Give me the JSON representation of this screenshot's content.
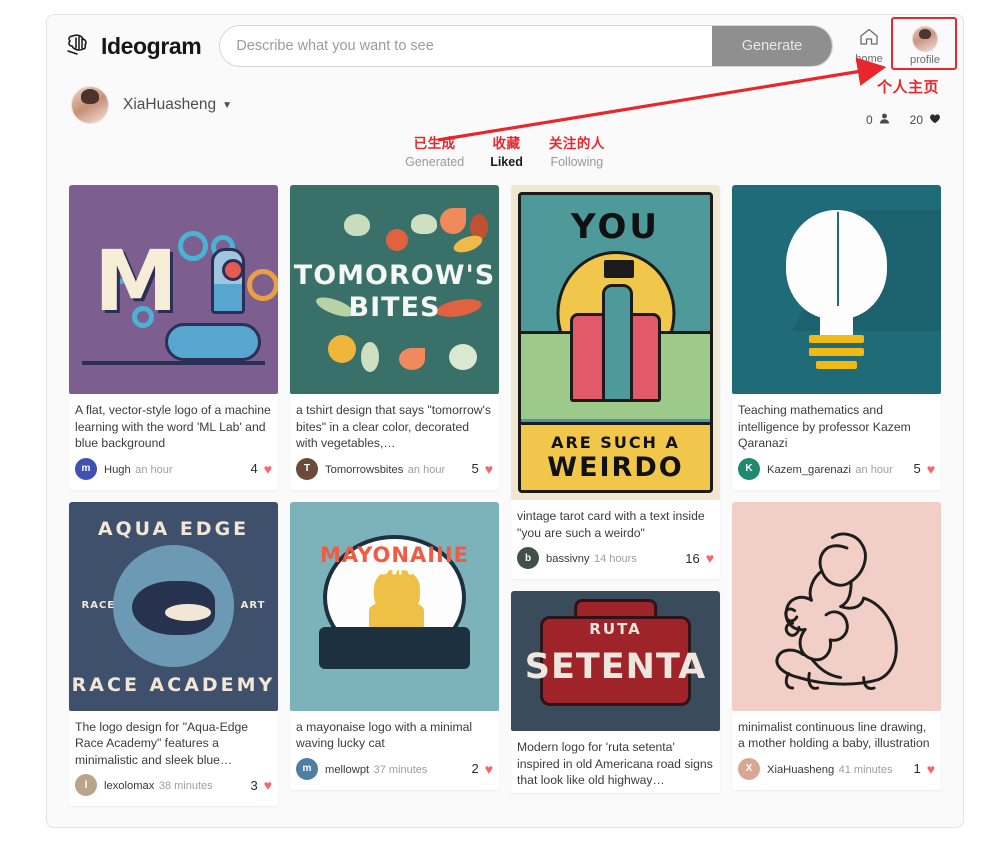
{
  "header": {
    "brand": "Ideogram",
    "logo_icon": "ideogram-brain-logo-icon",
    "search_placeholder": "Describe what you want to see",
    "search_value": "",
    "generate_label": "Generate",
    "nav": [
      {
        "name": "home",
        "label": "home",
        "icon": "home-icon"
      },
      {
        "name": "profile",
        "label": "profile",
        "icon": "avatar-icon"
      }
    ]
  },
  "annotations": {
    "profile_label_cn": "个人主页",
    "highlight_color": "#e8262b",
    "arrow": "red-arrow-pointing-to-profile"
  },
  "profile": {
    "username": "XiaHuasheng",
    "caret_icon": "chevron-down-icon",
    "avatar_icon": "user-avatar",
    "stats": {
      "followers": "0",
      "followers_icon": "person-icon",
      "likes": "20",
      "likes_icon": "heart-icon"
    }
  },
  "tabs": [
    {
      "cn": "已生成",
      "en": "Generated",
      "active": false
    },
    {
      "cn": "收藏",
      "en": "Liked",
      "active": true
    },
    {
      "cn": "关注的人",
      "en": "Following",
      "active": false
    }
  ],
  "feed": {
    "columns": [
      [
        {
          "art": "ml-lab",
          "caption": "A flat, vector-style logo of a machine learning with the word 'ML Lab' and blue background",
          "author": "Hugh",
          "author_initial": "m",
          "avatar_color": "#3f51b5",
          "time": "an hour",
          "likes": "4"
        },
        {
          "art": "aqua-edge",
          "caption": "The logo design for \"Aqua-Edge Race Academy\" features a minimalistic and sleek blue…",
          "author": "lexolomax",
          "author_initial": "l",
          "avatar_color": "#b9a48c",
          "time": "38 minutes",
          "likes": "3"
        }
      ],
      [
        {
          "art": "tomorrows-bites",
          "caption": "a tshirt design that says \"tomorrow's bites\" in a clear color, decorated with vegetables,…",
          "author": "Tomorrowsbites",
          "author_initial": "T",
          "avatar_color": "#6b4a3a",
          "time": "an hour",
          "likes": "5"
        },
        {
          "art": "mayonaise",
          "caption": "a mayonaise logo with a minimal waving lucky cat",
          "author": "mellowpt",
          "author_initial": "m",
          "avatar_color": "#4e7fa3",
          "time": "37 minutes",
          "likes": "2"
        }
      ],
      [
        {
          "art": "tarot-weirdo",
          "caption": "vintage tarot card with a text inside \"you are such a weirdo\"",
          "author": "bassivny",
          "author_initial": "b",
          "avatar_color": "#41514a",
          "time": "14 hours",
          "likes": "16"
        },
        {
          "art": "ruta-setenta",
          "caption": "Modern logo for 'ruta setenta' inspired in old Americana road signs that look like old highway…",
          "author": "",
          "author_initial": "",
          "avatar_color": "#888888",
          "time": "",
          "likes": ""
        }
      ],
      [
        {
          "art": "brain-bulb",
          "caption": "Teaching mathematics and intelligence by professor Kazem Qaranazi",
          "author": "Kazem_garenazi",
          "author_initial": "K",
          "avatar_color": "#1f8a6d",
          "time": "an hour",
          "likes": "5"
        },
        {
          "art": "mother-baby",
          "caption": "minimalist continuous line drawing, a mother holding a baby, illustration",
          "author": "XiaHuasheng",
          "author_initial": "X",
          "avatar_color": "#d8a894",
          "time": "41 minutes",
          "likes": "1"
        }
      ]
    ]
  },
  "artwork_text": {
    "ml_lab": "M",
    "bites_line1": "TOMOROW'S",
    "bites_line2": "BITES",
    "tarot_top": "YOU",
    "tarot_b1": "ARE SUCH A",
    "tarot_b2": "WEIRDO",
    "aqua_top": "AQUA EDGE",
    "aqua_bottom": "RACE ACADEMY",
    "aqua_left": "RACE",
    "aqua_right": "ART",
    "mayo_word": "MAYONAIIIE",
    "mayo_ribbon": "MAYONAIIIE",
    "setenta_top": "RUTA",
    "setenta_main": "SETENTA"
  }
}
